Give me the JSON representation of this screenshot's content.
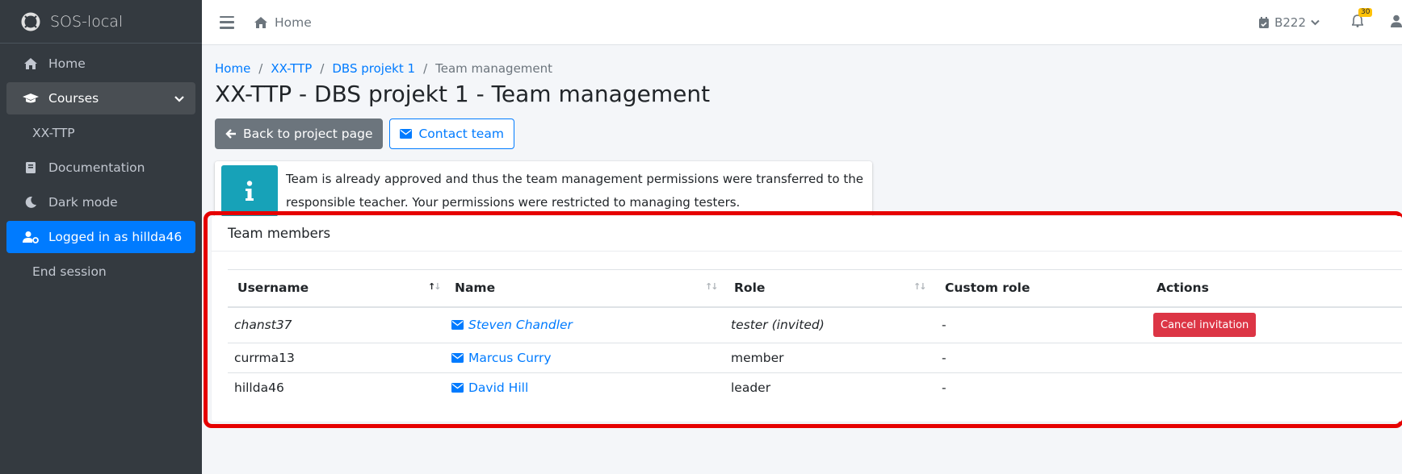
{
  "brand": {
    "name": "SOS-local"
  },
  "sidebar": {
    "items": [
      {
        "label": "Home",
        "icon": "home-icon"
      },
      {
        "label": "Courses",
        "icon": "graduation-cap-icon"
      },
      {
        "label": "XX-TTP"
      },
      {
        "label": "Documentation",
        "icon": "book-icon"
      },
      {
        "label": "Dark mode",
        "icon": "moon-icon"
      },
      {
        "label": "Logged in as hillda46",
        "icon": "user-cog-icon"
      },
      {
        "label": "End session"
      }
    ]
  },
  "topbar": {
    "home_label": "Home",
    "term_label": "B222",
    "notification_count": "30"
  },
  "breadcrumb": {
    "home": "Home",
    "course": "XX-TTP",
    "project": "DBS projekt 1",
    "current": "Team management"
  },
  "page": {
    "title": "XX-TTP - DBS projekt 1 - Team management",
    "back_label": "Back to project page",
    "contact_label": "Contact team",
    "info_line1": "Team is already approved and thus the team management permissions were transferred to the",
    "info_line2": "responsible teacher. Your permissions were restricted to managing testers."
  },
  "team": {
    "header": "Team members",
    "columns": [
      "Username",
      "Name",
      "Role",
      "Custom role",
      "Actions"
    ],
    "rows": [
      {
        "username": "chanst37",
        "name": "Steven Chandler",
        "role": "tester (invited)",
        "custom_role": "-",
        "action": "Cancel invitation"
      },
      {
        "username": "currma13",
        "name": "Marcus Curry",
        "role": "member",
        "custom_role": "-",
        "action": ""
      },
      {
        "username": "hillda46",
        "name": "David Hill",
        "role": "leader",
        "custom_role": "-",
        "action": ""
      }
    ]
  },
  "colors": {
    "sidebar_bg": "#343a40",
    "primary": "#007bff",
    "info": "#17a2b8",
    "danger": "#dc3545",
    "highlight": "#e60000"
  }
}
